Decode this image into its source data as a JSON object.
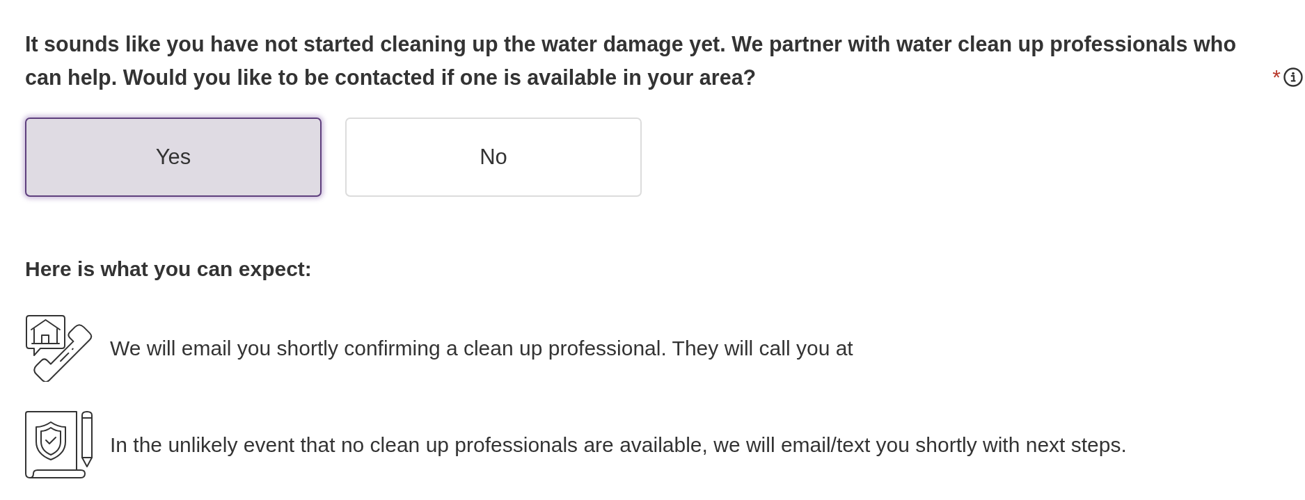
{
  "question": {
    "text": "It sounds like you have not started cleaning up the water damage yet. We partner with water clean up professionals who can help. Would you like to be contacted if one is available in your area?",
    "required_mark": "*"
  },
  "options": [
    {
      "label": "Yes",
      "selected": true
    },
    {
      "label": "No",
      "selected": false
    }
  ],
  "expectations": {
    "heading": "Here is what you can expect:",
    "items": [
      {
        "kind": "call",
        "text": "We will email you shortly confirming a clean up professional. They will call you at"
      },
      {
        "kind": "document",
        "text": "In the unlikely event that no clean up professionals are available, we will email/text you shortly with next steps."
      }
    ]
  }
}
